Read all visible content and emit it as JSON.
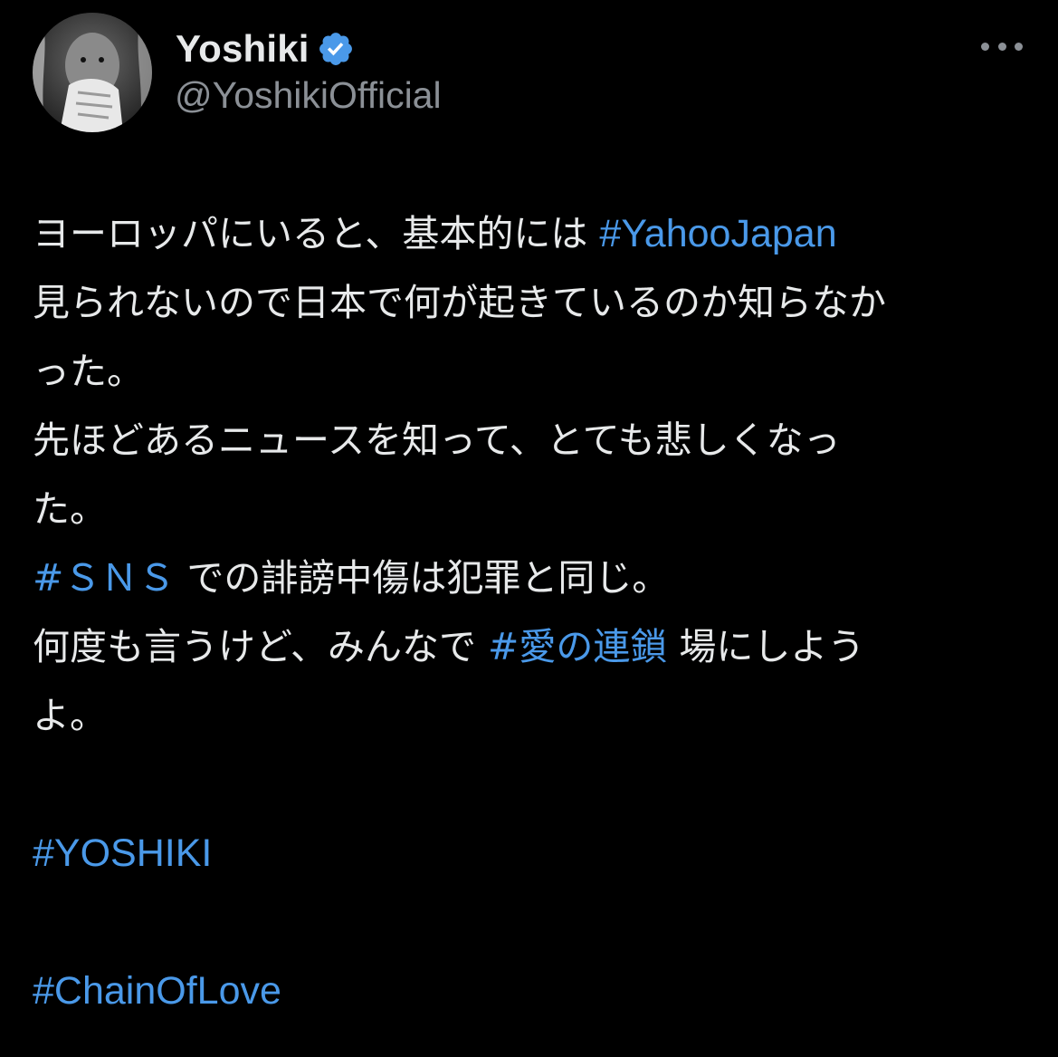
{
  "author": {
    "display_name": "Yoshiki",
    "handle": "@YoshikiOfficial",
    "verified": true
  },
  "menu": {
    "more_icon": "more-horizontal-icon"
  },
  "tweet": {
    "lines": [
      {
        "before": "ヨーロッパにいると、基本的には ",
        "tag": "#YahooJapan",
        "after": ""
      },
      {
        "before": "見られないので日本で何が起きているのか知らなか",
        "tag": "",
        "after": ""
      },
      {
        "before": "った。",
        "tag": "",
        "after": ""
      },
      {
        "before": "先ほどあるニュースを知って、とても悲しくなっ",
        "tag": "",
        "after": ""
      },
      {
        "before": "た。",
        "tag": "",
        "after": ""
      },
      {
        "before": "",
        "tag": "#ＳＮＳ",
        "after": " での誹謗中傷は犯罪と同じ。"
      },
      {
        "before": "何度も言うけど、みんなで ",
        "tag": "#愛の連鎖",
        "after": " 場にしよう"
      },
      {
        "before": "よ。",
        "tag": "",
        "after": ""
      }
    ],
    "hashtags_footer": [
      "#YOSHIKI",
      "#ChainOfLove"
    ]
  },
  "colors": {
    "background": "#000000",
    "text": "#e7e9ea",
    "secondary": "#8b9096",
    "link": "#4a99e9",
    "verified_badge": "#4a99e9"
  }
}
